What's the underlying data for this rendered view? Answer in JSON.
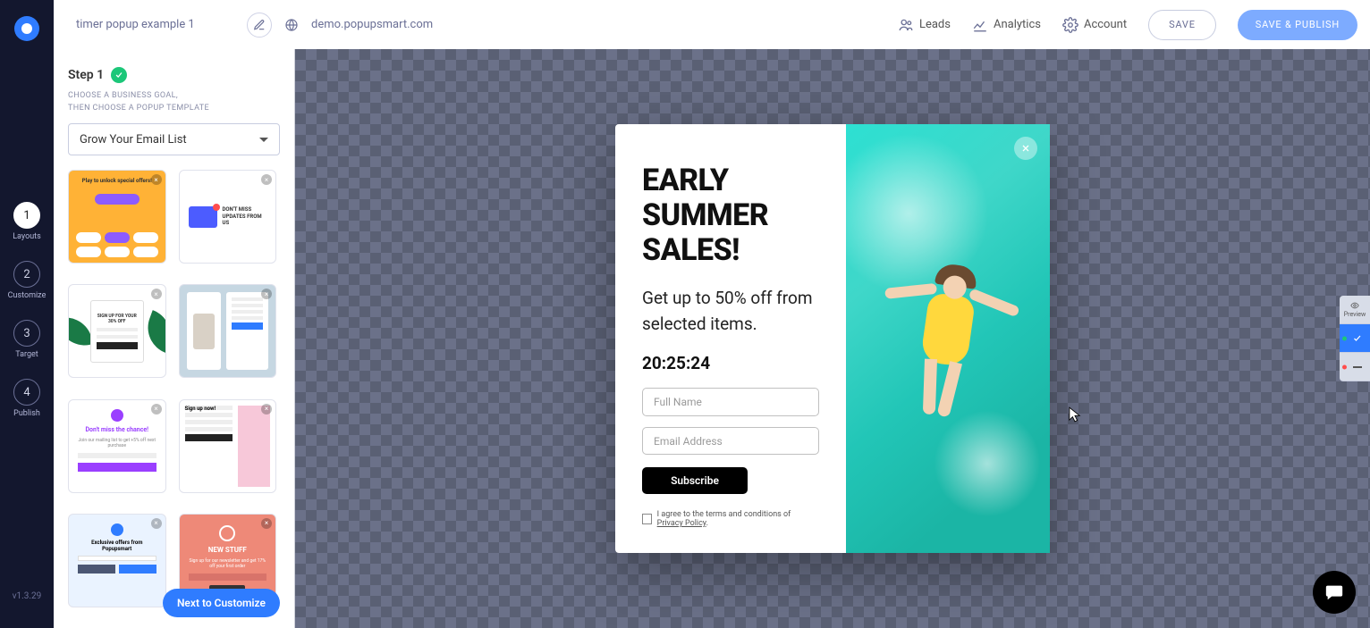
{
  "leftnav": {
    "steps": [
      {
        "num": "1",
        "label": "Layouts"
      },
      {
        "num": "2",
        "label": "Customize"
      },
      {
        "num": "3",
        "label": "Target"
      },
      {
        "num": "4",
        "label": "Publish"
      }
    ],
    "version": "v1.3.29"
  },
  "topbar": {
    "title_value": "timer popup example 1",
    "domain": "demo.popupsmart.com",
    "leads": "Leads",
    "analytics": "Analytics",
    "account": "Account",
    "save": "SAVE",
    "publish": "SAVE & PUBLISH"
  },
  "panel": {
    "step_title": "Step 1",
    "helper_line1": "CHOOSE A BUSINESS GOAL,",
    "helper_line2": "THEN CHOOSE A POPUP TEMPLATE",
    "select_value": "Grow Your Email List",
    "next_btn": "Next to Customize",
    "tpl1_bar": "Play to unlock special offers!",
    "tpl2_txt": "DON'T MISS UPDATES FROM US",
    "tpl3_txt": "SIGN UP FOR YOUR 30% OFF",
    "tpl5_t": "Don't miss the chance!",
    "tpl5_s": "Join our mailing list to get +5% off next purchase",
    "tpl6_t": "Sign up now!",
    "tpl7_t": "Exclusive offers from Popupsmart",
    "tpl8_t": "NEW STUFF",
    "tpl8_s": "Sign up for our newsletter and get 17% off your first order"
  },
  "popup": {
    "title_l1": "EARLY",
    "title_l2": "SUMMER",
    "title_l3": "SALES!",
    "sub": "Get up to 50% off from selected items.",
    "timer": "20:25:24",
    "name_ph": "Full Name",
    "email_ph": "Email Address",
    "subscribe": "Subscribe",
    "agree_text": "I agree to the terms and conditions of ",
    "agree_link": "Privacy Policy"
  },
  "rtabs": {
    "preview": "Preview"
  }
}
